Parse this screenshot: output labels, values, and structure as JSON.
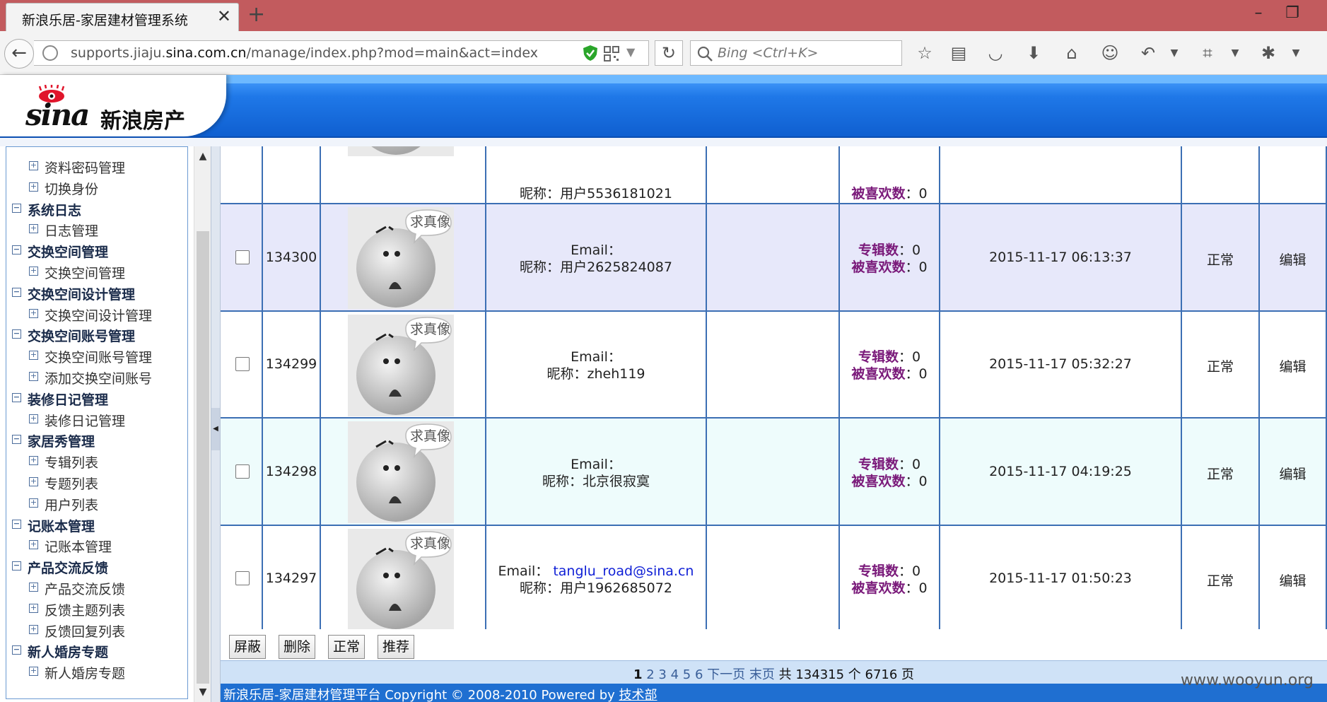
{
  "browser": {
    "tab_title": "新浪乐居-家居建材管理系统",
    "url_host_prefix": "supports.jiaju.",
    "url_host_main": "sina.com.cn",
    "url_path": "/manage/index.php?mod=main&act=index",
    "search_placeholder": "Bing <Ctrl+K>"
  },
  "header": {
    "logo_text": "sina",
    "logo_cn": "新浪房产"
  },
  "sidebar": {
    "rows": [
      {
        "type": "item",
        "label": "资料密码管理"
      },
      {
        "type": "item",
        "label": "切换身份"
      },
      {
        "type": "group",
        "label": "系统日志"
      },
      {
        "type": "item",
        "label": "日志管理"
      },
      {
        "type": "group",
        "label": "交换空间管理"
      },
      {
        "type": "item",
        "label": "交换空间管理"
      },
      {
        "type": "group",
        "label": "交换空间设计管理"
      },
      {
        "type": "item",
        "label": "交换空间设计管理"
      },
      {
        "type": "group",
        "label": "交换空间账号管理"
      },
      {
        "type": "item",
        "label": "交换空间账号管理"
      },
      {
        "type": "item",
        "label": "添加交换空间账号"
      },
      {
        "type": "group",
        "label": "装修日记管理"
      },
      {
        "type": "item",
        "label": "装修日记管理"
      },
      {
        "type": "group",
        "label": "家居秀管理"
      },
      {
        "type": "item",
        "label": "专辑列表"
      },
      {
        "type": "item",
        "label": "专题列表"
      },
      {
        "type": "item",
        "label": "用户列表"
      },
      {
        "type": "group",
        "label": "记账本管理"
      },
      {
        "type": "item",
        "label": "记账本管理"
      },
      {
        "type": "group",
        "label": "产品交流反馈"
      },
      {
        "type": "item",
        "label": "产品交流反馈"
      },
      {
        "type": "item",
        "label": "反馈主题列表"
      },
      {
        "type": "item",
        "label": "反馈回复列表"
      },
      {
        "type": "group",
        "label": "新人婚房专题"
      },
      {
        "type": "item",
        "label": "新人婚房专题"
      }
    ]
  },
  "table": {
    "avatar_caption": "求真像",
    "email_label": "Email：",
    "nickname_label": "昵称：",
    "albums_label": "专辑数",
    "likes_label": "被喜欢数",
    "colon_sep": "：",
    "partial_row": {
      "nickname": "用户5536181021",
      "likes": "0"
    },
    "rows": [
      {
        "id": "134300",
        "email": "",
        "nickname": "用户2625824087",
        "albums": "0",
        "likes": "0",
        "time": "2015-11-17 06:13:37",
        "status": "正常",
        "action": "编辑",
        "bg": "#e7e8fa"
      },
      {
        "id": "134299",
        "email": "",
        "nickname": "zheh119",
        "albums": "0",
        "likes": "0",
        "time": "2015-11-17 05:32:27",
        "status": "正常",
        "action": "编辑",
        "bg": "#ffffff"
      },
      {
        "id": "134298",
        "email": "",
        "nickname": "北京很寂寞",
        "albums": "0",
        "likes": "0",
        "time": "2015-11-17 04:19:25",
        "status": "正常",
        "action": "编辑",
        "bg": "#eefcfc"
      },
      {
        "id": "134297",
        "email": "tanglu_road@sina.cn",
        "nickname": "用户1962685072",
        "albums": "0",
        "likes": "0",
        "time": "2015-11-17 01:50:23",
        "status": "正常",
        "action": "编辑",
        "bg": "#ffffff"
      }
    ]
  },
  "actions": {
    "block": "屏蔽",
    "delete": "删除",
    "normal": "正常",
    "recommend": "推荐"
  },
  "pager": {
    "current": "1",
    "pages": [
      "2",
      "3",
      "4",
      "5",
      "6"
    ],
    "next": "下一页",
    "last": "末页",
    "summary": "共 134315 个 6716 页"
  },
  "footer": {
    "text": "新浪乐居-家居建材管理平台 Copyright © 2008-2010  Powered by ",
    "link": "技术部"
  },
  "watermark": "www.wooyun.org"
}
